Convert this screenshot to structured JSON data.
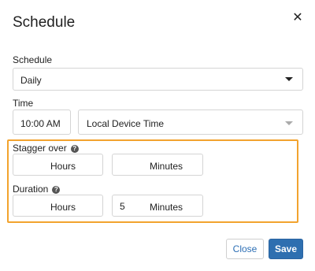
{
  "dialog": {
    "title": "Schedule",
    "close_icon": "close-icon"
  },
  "schedule": {
    "label": "Schedule",
    "value": "Daily"
  },
  "time": {
    "label": "Time",
    "value": "10:00 AM",
    "timezone": "Local Device Time"
  },
  "stagger": {
    "label": "Stagger over",
    "hours_suffix": "Hours",
    "minutes_suffix": "Minutes",
    "hours_value": "",
    "minutes_value": ""
  },
  "duration": {
    "label": "Duration",
    "hours_suffix": "Hours",
    "minutes_suffix": "Minutes",
    "hours_value": "",
    "minutes_value": "5"
  },
  "footer": {
    "close_label": "Close",
    "save_label": "Save"
  },
  "colors": {
    "highlight": "#f2a32e",
    "primary": "#2e6fb0"
  }
}
